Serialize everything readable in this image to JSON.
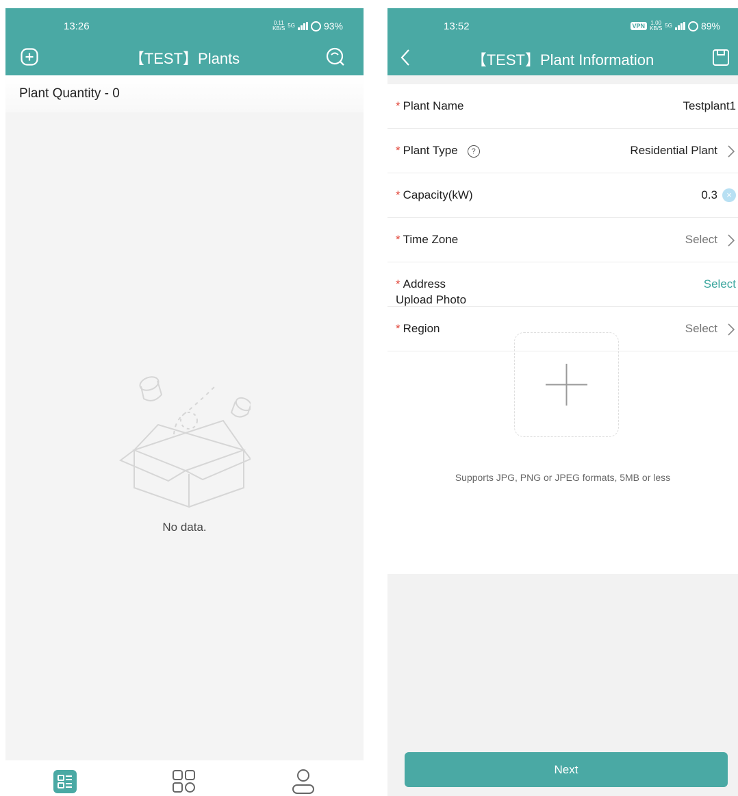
{
  "colors": {
    "accent": "#4aa9a4",
    "required": "#e2483c",
    "link": "#3aa59d"
  },
  "left": {
    "status": {
      "time": "13:26",
      "speed_value": "0.11",
      "speed_unit": "KB/S",
      "network": "5G",
      "battery": "93%"
    },
    "header": {
      "title": "【TEST】Plants",
      "add_icon": "add-square-icon",
      "search_icon": "search-icon"
    },
    "quantity_label": "Plant Quantity - 0",
    "empty_text": "No data.",
    "nav": [
      {
        "icon": "list-icon",
        "active": true
      },
      {
        "icon": "grid-icon",
        "active": false
      },
      {
        "icon": "user-icon",
        "active": false
      }
    ]
  },
  "right": {
    "status": {
      "time": "13:52",
      "vpn": "VPN",
      "speed_value": "1.00",
      "speed_unit": "KB/S",
      "network": "5G",
      "battery": "89%"
    },
    "header": {
      "title": "【TEST】Plant Information",
      "back_icon": "back-arrow-icon",
      "save_icon": "save-icon"
    },
    "form": {
      "required_mark": "*",
      "plant_name": {
        "label": "Plant Name",
        "value": "Testplant1"
      },
      "plant_type": {
        "label": "Plant Type",
        "help": "?",
        "value": "Residential Plant"
      },
      "capacity": {
        "label": "Capacity(kW)",
        "value": "0.3",
        "clear": "×"
      },
      "time_zone": {
        "label": "Time Zone",
        "value": "Select"
      },
      "address": {
        "label": "Address",
        "value": "Select"
      },
      "region": {
        "label": "Region",
        "value": "Select"
      }
    },
    "upload": {
      "label": "Upload Photo",
      "hint": "Supports JPG, PNG or JPEG formats, 5MB or less"
    },
    "next_label": "Next"
  }
}
